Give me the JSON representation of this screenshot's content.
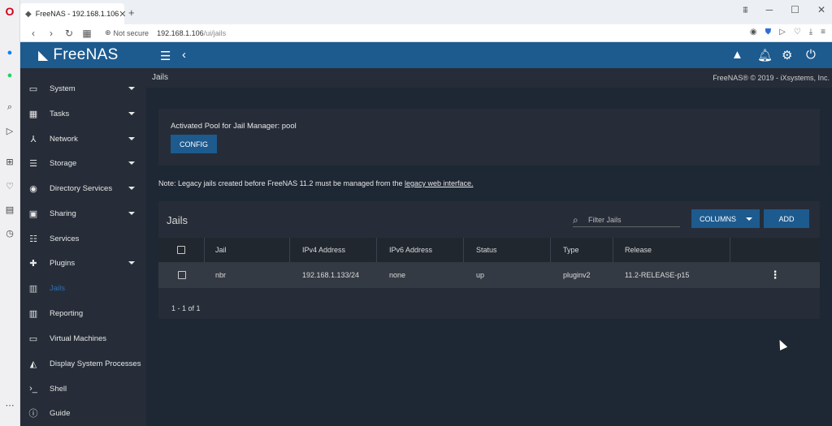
{
  "browser": {
    "tab_title": "FreeNAS - 192.168.1.106",
    "tab_close": "✕",
    "new_tab": "+",
    "security_label": "Not secure",
    "url_host": "192.168.1.106",
    "url_path": "/ui/jails",
    "window_controls": [
      "⩩",
      "─",
      "☐",
      "✕"
    ]
  },
  "opera_sidebar_icons": [
    "opera-logo-icon",
    "messenger-icon",
    "whatsapp-icon",
    "search-icon",
    "send-icon",
    "speed-dial-icon",
    "heart-icon",
    "news-icon",
    "history-icon",
    "more-icon"
  ],
  "app": {
    "logo_text": "FreeNAS",
    "breadcrumb": "Jails",
    "copyright": "FreeNAS® © 2019 - iXsystems, Inc."
  },
  "sidebar": {
    "items": [
      {
        "label": "System",
        "icon": "laptop-icon",
        "caret": true
      },
      {
        "label": "Tasks",
        "icon": "calendar-icon",
        "caret": true
      },
      {
        "label": "Network",
        "icon": "network-icon",
        "caret": true
      },
      {
        "label": "Storage",
        "icon": "storage-icon",
        "caret": true
      },
      {
        "label": "Directory Services",
        "icon": "directory-icon",
        "caret": true
      },
      {
        "label": "Sharing",
        "icon": "folder-share-icon",
        "caret": true
      },
      {
        "label": "Services",
        "icon": "sliders-icon",
        "caret": false
      },
      {
        "label": "Plugins",
        "icon": "puzzle-icon",
        "caret": true
      },
      {
        "label": "Jails",
        "icon": "jail-icon",
        "caret": false,
        "active": true
      },
      {
        "label": "Reporting",
        "icon": "chart-icon",
        "caret": false
      },
      {
        "label": "Virtual Machines",
        "icon": "monitor-icon",
        "caret": false
      },
      {
        "label": "Display System Processes",
        "icon": "processes-icon",
        "caret": false
      },
      {
        "label": "Shell",
        "icon": "terminal-icon",
        "caret": false
      },
      {
        "label": "Guide",
        "icon": "info-icon",
        "caret": false
      }
    ]
  },
  "pool_card": {
    "label": "Activated Pool for Jail Manager: pool",
    "config_button": "CONFIG"
  },
  "note": {
    "text": "Note: Legacy jails created before FreeNAS 11.2 must be managed from the",
    "link": "legacy web interface."
  },
  "jails_table": {
    "title": "Jails",
    "filter_placeholder": "Filter Jails",
    "columns_button": "COLUMNS",
    "add_button": "ADD",
    "headers": [
      "Jail",
      "IPv4 Address",
      "IPv6 Address",
      "Status",
      "Type",
      "Release"
    ],
    "rows": [
      {
        "jail": "nbr",
        "ipv4": "192.168.1.133/24",
        "ipv6": "none",
        "status": "up",
        "type": "pluginv2",
        "release": "11.2-RELEASE-p15"
      }
    ],
    "pager": "1 - 1 of 1"
  },
  "colors": {
    "accent": "#1d5a8e",
    "sidebar_bg": "#262d38",
    "content_bg": "#1e2734",
    "active_nav": "#2e6fb0"
  }
}
